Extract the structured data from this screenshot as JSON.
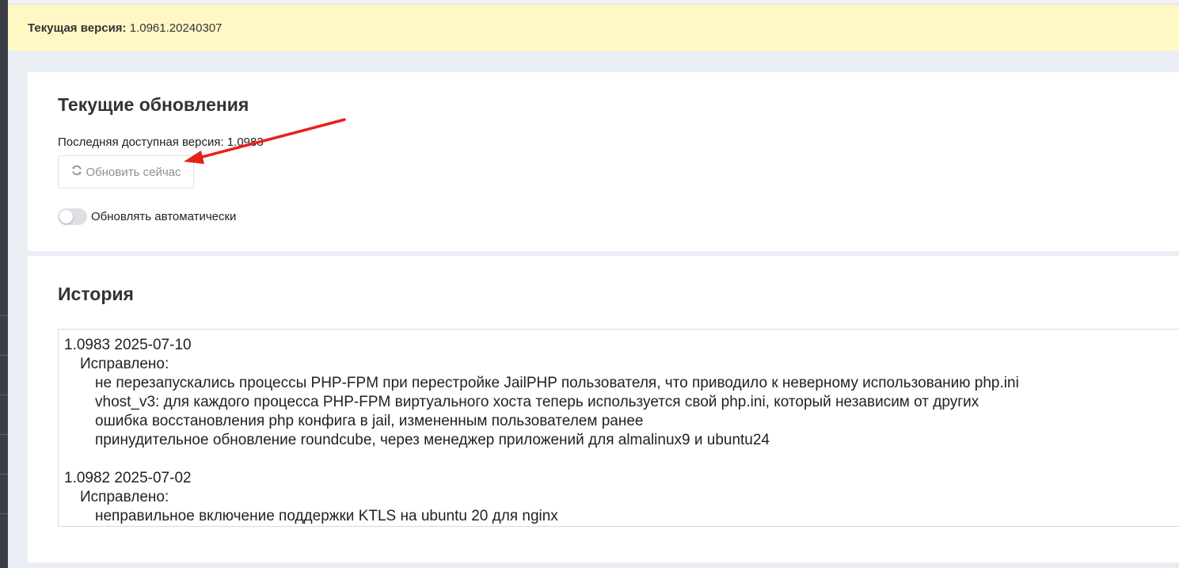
{
  "version_bar": {
    "label": "Текущая версия:",
    "value": "1.0961.20240307"
  },
  "updates": {
    "title": "Текущие обновления",
    "latest_text": "Последняя доступная версия: 1.0983",
    "update_button": "Обновить сейчас",
    "update_icon": "refresh-icon",
    "auto_update_label": "Обновлять автоматически",
    "auto_update_enabled": false
  },
  "history": {
    "title": "История",
    "entries": [
      {
        "header": "1.0983 2025-07-10",
        "section": "Исправлено:",
        "items": [
          "не перезапускались процессы PHP-FPM при перестройке JailPHP пользователя, что приводило к неверному использованию php.ini",
          "vhost_v3: для каждого процесса PHP-FPM виртуального хоста теперь используется свой php.ini, который независим от других",
          "ошибка восстановления php конфига в jail, измененным пользователем ранее",
          "принудительное обновление roundcube, через менеджер приложений для almalinux9 и ubuntu24"
        ]
      },
      {
        "header": "1.0982 2025-07-02",
        "section": "Исправлено:",
        "items": [
          "неправильное включение поддержки KTLS на ubuntu 20 для nginx"
        ]
      }
    ]
  },
  "colors": {
    "version_bar_bg": "#fff8c5",
    "page_bg": "#e9edf4",
    "annotation_arrow": "#e8201c"
  }
}
